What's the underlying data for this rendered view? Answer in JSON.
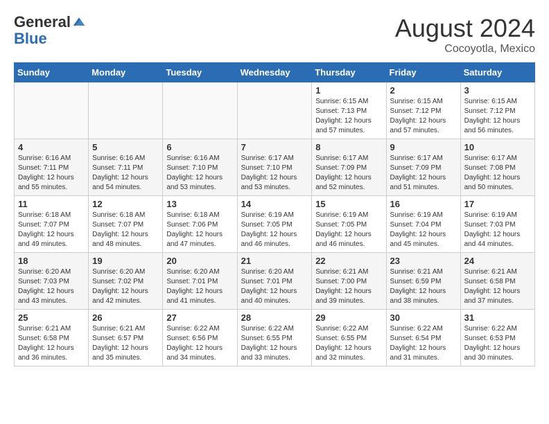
{
  "header": {
    "logo_line1": "General",
    "logo_line2": "Blue",
    "month_year": "August 2024",
    "location": "Cocoyotla, Mexico"
  },
  "weekdays": [
    "Sunday",
    "Monday",
    "Tuesday",
    "Wednesday",
    "Thursday",
    "Friday",
    "Saturday"
  ],
  "weeks": [
    [
      {
        "day": "",
        "info": ""
      },
      {
        "day": "",
        "info": ""
      },
      {
        "day": "",
        "info": ""
      },
      {
        "day": "",
        "info": ""
      },
      {
        "day": "1",
        "info": "Sunrise: 6:15 AM\nSunset: 7:13 PM\nDaylight: 12 hours\nand 57 minutes."
      },
      {
        "day": "2",
        "info": "Sunrise: 6:15 AM\nSunset: 7:12 PM\nDaylight: 12 hours\nand 57 minutes."
      },
      {
        "day": "3",
        "info": "Sunrise: 6:15 AM\nSunset: 7:12 PM\nDaylight: 12 hours\nand 56 minutes."
      }
    ],
    [
      {
        "day": "4",
        "info": "Sunrise: 6:16 AM\nSunset: 7:11 PM\nDaylight: 12 hours\nand 55 minutes."
      },
      {
        "day": "5",
        "info": "Sunrise: 6:16 AM\nSunset: 7:11 PM\nDaylight: 12 hours\nand 54 minutes."
      },
      {
        "day": "6",
        "info": "Sunrise: 6:16 AM\nSunset: 7:10 PM\nDaylight: 12 hours\nand 53 minutes."
      },
      {
        "day": "7",
        "info": "Sunrise: 6:17 AM\nSunset: 7:10 PM\nDaylight: 12 hours\nand 53 minutes."
      },
      {
        "day": "8",
        "info": "Sunrise: 6:17 AM\nSunset: 7:09 PM\nDaylight: 12 hours\nand 52 minutes."
      },
      {
        "day": "9",
        "info": "Sunrise: 6:17 AM\nSunset: 7:09 PM\nDaylight: 12 hours\nand 51 minutes."
      },
      {
        "day": "10",
        "info": "Sunrise: 6:17 AM\nSunset: 7:08 PM\nDaylight: 12 hours\nand 50 minutes."
      }
    ],
    [
      {
        "day": "11",
        "info": "Sunrise: 6:18 AM\nSunset: 7:07 PM\nDaylight: 12 hours\nand 49 minutes."
      },
      {
        "day": "12",
        "info": "Sunrise: 6:18 AM\nSunset: 7:07 PM\nDaylight: 12 hours\nand 48 minutes."
      },
      {
        "day": "13",
        "info": "Sunrise: 6:18 AM\nSunset: 7:06 PM\nDaylight: 12 hours\nand 47 minutes."
      },
      {
        "day": "14",
        "info": "Sunrise: 6:19 AM\nSunset: 7:05 PM\nDaylight: 12 hours\nand 46 minutes."
      },
      {
        "day": "15",
        "info": "Sunrise: 6:19 AM\nSunset: 7:05 PM\nDaylight: 12 hours\nand 46 minutes."
      },
      {
        "day": "16",
        "info": "Sunrise: 6:19 AM\nSunset: 7:04 PM\nDaylight: 12 hours\nand 45 minutes."
      },
      {
        "day": "17",
        "info": "Sunrise: 6:19 AM\nSunset: 7:03 PM\nDaylight: 12 hours\nand 44 minutes."
      }
    ],
    [
      {
        "day": "18",
        "info": "Sunrise: 6:20 AM\nSunset: 7:03 PM\nDaylight: 12 hours\nand 43 minutes."
      },
      {
        "day": "19",
        "info": "Sunrise: 6:20 AM\nSunset: 7:02 PM\nDaylight: 12 hours\nand 42 minutes."
      },
      {
        "day": "20",
        "info": "Sunrise: 6:20 AM\nSunset: 7:01 PM\nDaylight: 12 hours\nand 41 minutes."
      },
      {
        "day": "21",
        "info": "Sunrise: 6:20 AM\nSunset: 7:01 PM\nDaylight: 12 hours\nand 40 minutes."
      },
      {
        "day": "22",
        "info": "Sunrise: 6:21 AM\nSunset: 7:00 PM\nDaylight: 12 hours\nand 39 minutes."
      },
      {
        "day": "23",
        "info": "Sunrise: 6:21 AM\nSunset: 6:59 PM\nDaylight: 12 hours\nand 38 minutes."
      },
      {
        "day": "24",
        "info": "Sunrise: 6:21 AM\nSunset: 6:58 PM\nDaylight: 12 hours\nand 37 minutes."
      }
    ],
    [
      {
        "day": "25",
        "info": "Sunrise: 6:21 AM\nSunset: 6:58 PM\nDaylight: 12 hours\nand 36 minutes."
      },
      {
        "day": "26",
        "info": "Sunrise: 6:21 AM\nSunset: 6:57 PM\nDaylight: 12 hours\nand 35 minutes."
      },
      {
        "day": "27",
        "info": "Sunrise: 6:22 AM\nSunset: 6:56 PM\nDaylight: 12 hours\nand 34 minutes."
      },
      {
        "day": "28",
        "info": "Sunrise: 6:22 AM\nSunset: 6:55 PM\nDaylight: 12 hours\nand 33 minutes."
      },
      {
        "day": "29",
        "info": "Sunrise: 6:22 AM\nSunset: 6:55 PM\nDaylight: 12 hours\nand 32 minutes."
      },
      {
        "day": "30",
        "info": "Sunrise: 6:22 AM\nSunset: 6:54 PM\nDaylight: 12 hours\nand 31 minutes."
      },
      {
        "day": "31",
        "info": "Sunrise: 6:22 AM\nSunset: 6:53 PM\nDaylight: 12 hours\nand 30 minutes."
      }
    ]
  ]
}
